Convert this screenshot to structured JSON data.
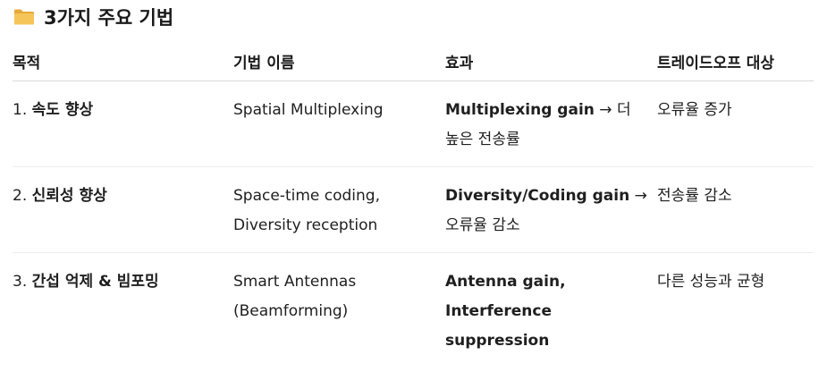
{
  "heading": {
    "icon": "folder-icon",
    "text": "3가지 주요 기법"
  },
  "table": {
    "headers": [
      "목적",
      "기법 이름",
      "효과",
      "트레이드오프 대상"
    ],
    "rows": [
      {
        "purpose_num": "1.",
        "purpose": "속도 향상",
        "technique": "Spatial Multiplexing",
        "effect_bold": "Multiplexing gain",
        "effect_rest": " → 더 높은 전송률",
        "tradeoff": "오류율 증가"
      },
      {
        "purpose_num": "2.",
        "purpose": "신뢰성 향상",
        "technique": "Space-time coding, Diversity reception",
        "effect_bold": "Diversity/Coding gain",
        "effect_rest": " → 오류율 감소",
        "tradeoff": "전송률 감소"
      },
      {
        "purpose_num": "3.",
        "purpose": "간섭 억제 & 빔포밍",
        "technique": "Smart Antennas (Beamforming)",
        "effect_bold": "Antenna gain, Interference suppression",
        "effect_rest": "",
        "tradeoff": "다른 성능과 균형"
      }
    ]
  }
}
